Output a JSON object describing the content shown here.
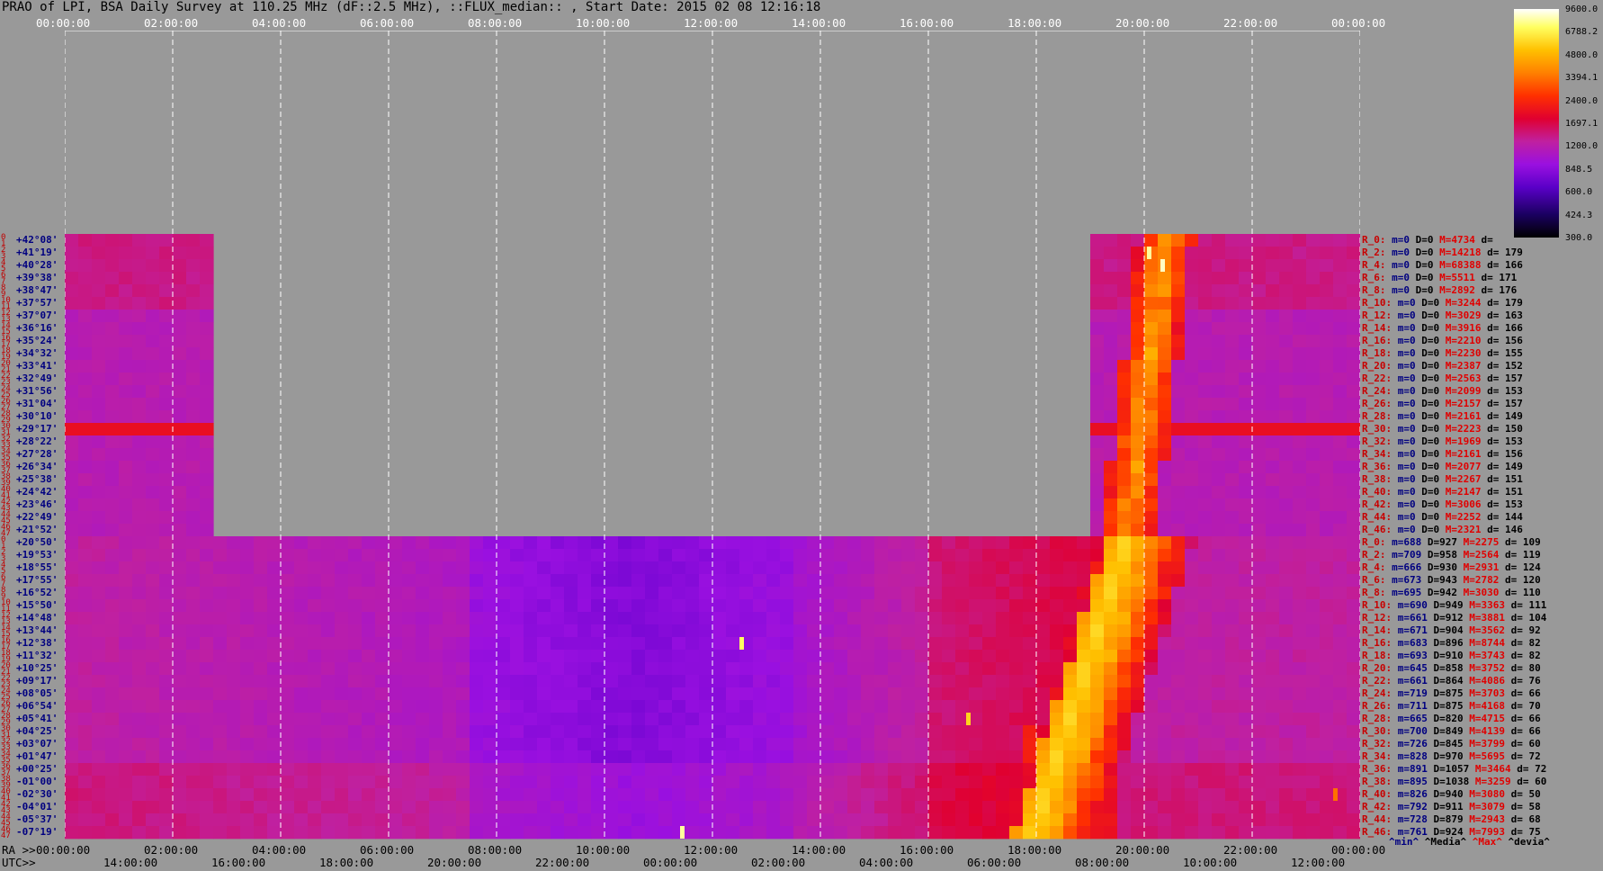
{
  "title": "PRAO of LPI, BSA Daily Survey at 110.25 MHz (dF::2.5 MHz), ::FLUX_median:: , Start Date: 2015 02 08 12:16:18",
  "top_time_labels": [
    "00:00:00",
    "02:00:00",
    "04:00:00",
    "06:00:00",
    "08:00:00",
    "10:00:00",
    "12:00:00",
    "14:00:00",
    "16:00:00",
    "18:00:00",
    "20:00:00",
    "22:00:00",
    "00:00:00"
  ],
  "ra_prefix": "RA >>",
  "ra_labels": [
    "00:00:00",
    "02:00:00",
    "04:00:00",
    "06:00:00",
    "08:00:00",
    "10:00:00",
    "12:00:00",
    "14:00:00",
    "16:00:00",
    "18:00:00",
    "20:00:00",
    "22:00:00",
    "00:00:00"
  ],
  "utc_prefix": "UTC>>",
  "utc_labels": [
    "14:00:00",
    "16:00:00",
    "18:00:00",
    "20:00:00",
    "22:00:00",
    "00:00:00",
    "02:00:00",
    "04:00:00",
    "06:00:00",
    "08:00:00",
    "10:00:00",
    "12:00:00"
  ],
  "upper_block_dec": [
    "+42°08'",
    "+41°19'",
    "+40°28'",
    "+39°38'",
    "+38°47'",
    "+37°57'",
    "+37°07'",
    "+36°16'",
    "+35°24'",
    "+34°32'",
    "+33°41'",
    "+32°49'",
    "+31°56'",
    "+31°04'",
    "+30°10'",
    "+29°17'",
    "+28°22'",
    "+27°28'",
    "+26°34'",
    "+25°38'",
    "+24°42'",
    "+23°46'",
    "+22°49'",
    "+21°52'"
  ],
  "lower_block_dec": [
    "+20°50'",
    "+19°53'",
    "+18°55'",
    "+17°55'",
    "+16°52'",
    "+15°50'",
    "+14°48'",
    "+13°44'",
    "+12°38'",
    "+11°32'",
    "+10°25'",
    "+09°17'",
    "+08°05'",
    "+06°54'",
    "+05°41'",
    "+04°25'",
    "+03°07'",
    "+01°47'",
    "+00°25'",
    "-01°00'",
    "-02°30'",
    "-04°01'",
    "-05°37'",
    "-07°19'"
  ],
  "upper_index": [
    "0",
    "2",
    "4",
    "6",
    "8",
    "10",
    "12",
    "14",
    "16",
    "18",
    "20",
    "22",
    "24",
    "26",
    "28",
    "30",
    "32",
    "34",
    "36",
    "38",
    "40",
    "42",
    "44",
    "46"
  ],
  "lower_index": [
    "1",
    "3",
    "5",
    "7",
    "9",
    "11",
    "13",
    "15",
    "17",
    "19",
    "21",
    "23",
    "25",
    "27",
    "29",
    "31",
    "33",
    "35",
    "37",
    "39",
    "41",
    "43",
    "45",
    "47"
  ],
  "right_stats": [
    {
      "r": "R_0:",
      "m": "m=0",
      "D": "D=0",
      "M": "M=4734",
      "d": "d="
    },
    {
      "r": "R_2:",
      "m": "m=0",
      "D": "D=0",
      "M": "M=14218",
      "d": "d= 179"
    },
    {
      "r": "R_4:",
      "m": "m=0",
      "D": "D=0",
      "M": "M=68388",
      "d": "d= 166"
    },
    {
      "r": "R_6:",
      "m": "m=0",
      "D": "D=0",
      "M": "M=5511",
      "d": "d= 171"
    },
    {
      "r": "R_8:",
      "m": "m=0",
      "D": "D=0",
      "M": "M=2892",
      "d": "d= 176"
    },
    {
      "r": "R_10:",
      "m": "m=0",
      "D": "D=0",
      "M": "M=3244",
      "d": "d= 179"
    },
    {
      "r": "R_12:",
      "m": "m=0",
      "D": "D=0",
      "M": "M=3029",
      "d": "d= 163"
    },
    {
      "r": "R_14:",
      "m": "m=0",
      "D": "D=0",
      "M": "M=3916",
      "d": "d= 166"
    },
    {
      "r": "R_16:",
      "m": "m=0",
      "D": "D=0",
      "M": "M=2210",
      "d": "d= 156"
    },
    {
      "r": "R_18:",
      "m": "m=0",
      "D": "D=0",
      "M": "M=2230",
      "d": "d= 155"
    },
    {
      "r": "R_20:",
      "m": "m=0",
      "D": "D=0",
      "M": "M=2387",
      "d": "d= 152"
    },
    {
      "r": "R_22:",
      "m": "m=0",
      "D": "D=0",
      "M": "M=2563",
      "d": "d= 157"
    },
    {
      "r": "R_24:",
      "m": "m=0",
      "D": "D=0",
      "M": "M=2099",
      "d": "d= 153"
    },
    {
      "r": "R_26:",
      "m": "m=0",
      "D": "D=0",
      "M": "M=2157",
      "d": "d= 157"
    },
    {
      "r": "R_28:",
      "m": "m=0",
      "D": "D=0",
      "M": "M=2161",
      "d": "d= 149"
    },
    {
      "r": "R_30:",
      "m": "m=0",
      "D": "D=0",
      "M": "M=2223",
      "d": "d= 150"
    },
    {
      "r": "R_32:",
      "m": "m=0",
      "D": "D=0",
      "M": "M=1969",
      "d": "d= 153"
    },
    {
      "r": "R_34:",
      "m": "m=0",
      "D": "D=0",
      "M": "M=2161",
      "d": "d= 156"
    },
    {
      "r": "R_36:",
      "m": "m=0",
      "D": "D=0",
      "M": "M=2077",
      "d": "d= 149"
    },
    {
      "r": "R_38:",
      "m": "m=0",
      "D": "D=0",
      "M": "M=2267",
      "d": "d= 151"
    },
    {
      "r": "R_40:",
      "m": "m=0",
      "D": "D=0",
      "M": "M=2147",
      "d": "d= 151"
    },
    {
      "r": "R_42:",
      "m": "m=0",
      "D": "D=0",
      "M": "M=3006",
      "d": "d= 153"
    },
    {
      "r": "R_44:",
      "m": "m=0",
      "D": "D=0",
      "M": "M=2252",
      "d": "d= 144"
    },
    {
      "r": "R_46:",
      "m": "m=0",
      "D": "D=0",
      "M": "M=2321",
      "d": "d= 146"
    },
    {
      "r": "R_0:",
      "m": "m=688",
      "D": "D=927",
      "M": "M=2275",
      "d": "d= 109"
    },
    {
      "r": "R_2:",
      "m": "m=709",
      "D": "D=958",
      "M": "M=2564",
      "d": "d= 119"
    },
    {
      "r": "R_4:",
      "m": "m=666",
      "D": "D=930",
      "M": "M=2931",
      "d": "d= 124"
    },
    {
      "r": "R_6:",
      "m": "m=673",
      "D": "D=943",
      "M": "M=2782",
      "d": "d= 120"
    },
    {
      "r": "R_8:",
      "m": "m=695",
      "D": "D=942",
      "M": "M=3030",
      "d": "d= 110"
    },
    {
      "r": "R_10:",
      "m": "m=690",
      "D": "D=949",
      "M": "M=3363",
      "d": "d= 111"
    },
    {
      "r": "R_12:",
      "m": "m=661",
      "D": "D=912",
      "M": "M=3881",
      "d": "d= 104"
    },
    {
      "r": "R_14:",
      "m": "m=671",
      "D": "D=904",
      "M": "M=3562",
      "d": "d= 92"
    },
    {
      "r": "R_16:",
      "m": "m=683",
      "D": "D=896",
      "M": "M=8744",
      "d": "d= 82"
    },
    {
      "r": "R_18:",
      "m": "m=693",
      "D": "D=910",
      "M": "M=3743",
      "d": "d= 82"
    },
    {
      "r": "R_20:",
      "m": "m=645",
      "D": "D=858",
      "M": "M=3752",
      "d": "d= 80"
    },
    {
      "r": "R_22:",
      "m": "m=661",
      "D": "D=864",
      "M": "M=4086",
      "d": "d= 76"
    },
    {
      "r": "R_24:",
      "m": "m=719",
      "D": "D=875",
      "M": "M=3703",
      "d": "d= 66"
    },
    {
      "r": "R_26:",
      "m": "m=711",
      "D": "D=875",
      "M": "M=4168",
      "d": "d= 70"
    },
    {
      "r": "R_28:",
      "m": "m=665",
      "D": "D=820",
      "M": "M=4715",
      "d": "d= 66"
    },
    {
      "r": "R_30:",
      "m": "m=700",
      "D": "D=849",
      "M": "M=4139",
      "d": "d= 66"
    },
    {
      "r": "R_32:",
      "m": "m=726",
      "D": "D=845",
      "M": "M=3799",
      "d": "d= 60"
    },
    {
      "r": "R_34:",
      "m": "m=828",
      "D": "D=970",
      "M": "M=5695",
      "d": "d= 72"
    },
    {
      "r": "R_36:",
      "m": "m=891",
      "D": "D=1057",
      "M": "M=3464",
      "d": "d= 72"
    },
    {
      "r": "R_38:",
      "m": "m=895",
      "D": "D=1038",
      "M": "M=3259",
      "d": "d= 60"
    },
    {
      "r": "R_40:",
      "m": "m=826",
      "D": "D=940",
      "M": "M=3080",
      "d": "d= 50"
    },
    {
      "r": "R_42:",
      "m": "m=792",
      "D": "D=911",
      "M": "M=3079",
      "d": "d= 58"
    },
    {
      "r": "R_44:",
      "m": "m=728",
      "D": "D=879",
      "M": "M=2943",
      "d": "d= 68"
    },
    {
      "r": "R_46:",
      "m": "m=761",
      "D": "D=924",
      "M": "M=7993",
      "d": "d= 75"
    }
  ],
  "footer": {
    "min": "^min^",
    "median": "^Media^",
    "max": "^Max^",
    "dev": "^devia^"
  },
  "chart_data": {
    "type": "heatmap",
    "title": "PRAO of LPI, BSA Daily Survey at 110.25 MHz (dF::2.5 MHz), ::FLUX_median:: , Start Date: 2015 02 08 12:16:18",
    "x_axis_top_labels": [
      "00:00:00",
      "02:00:00",
      "04:00:00",
      "06:00:00",
      "08:00:00",
      "10:00:00",
      "12:00:00",
      "14:00:00",
      "16:00:00",
      "18:00:00",
      "20:00:00",
      "22:00:00",
      "00:00:00"
    ],
    "colorbar": {
      "ticks": [
        9600.0,
        6788.2,
        4800.0,
        3394.1,
        2400.0,
        1697.1,
        1200.0,
        848.5,
        600.0,
        424.3,
        300.0
      ],
      "tick_labels": [
        "9600.0",
        "6788.2",
        "4800.0",
        "3394.1",
        "2400.0",
        "1697.1",
        "1200.0",
        "848.5",
        "600.0",
        "424.3",
        "300.0"
      ],
      "scale": "log",
      "range": [
        300.0,
        9600.0
      ],
      "colors": [
        "#000000",
        "#1a0060",
        "#5a00c8",
        "#9a10e0",
        "#c020a0",
        "#e00030",
        "#ff3000",
        "#ff8000",
        "#ffc000",
        "#ffff60",
        "#ffffff"
      ]
    },
    "accent_colors": {
      "background": "#999999",
      "grid": "#ffffff",
      "label_red": "#c80000",
      "label_blue": "#000080"
    }
  }
}
